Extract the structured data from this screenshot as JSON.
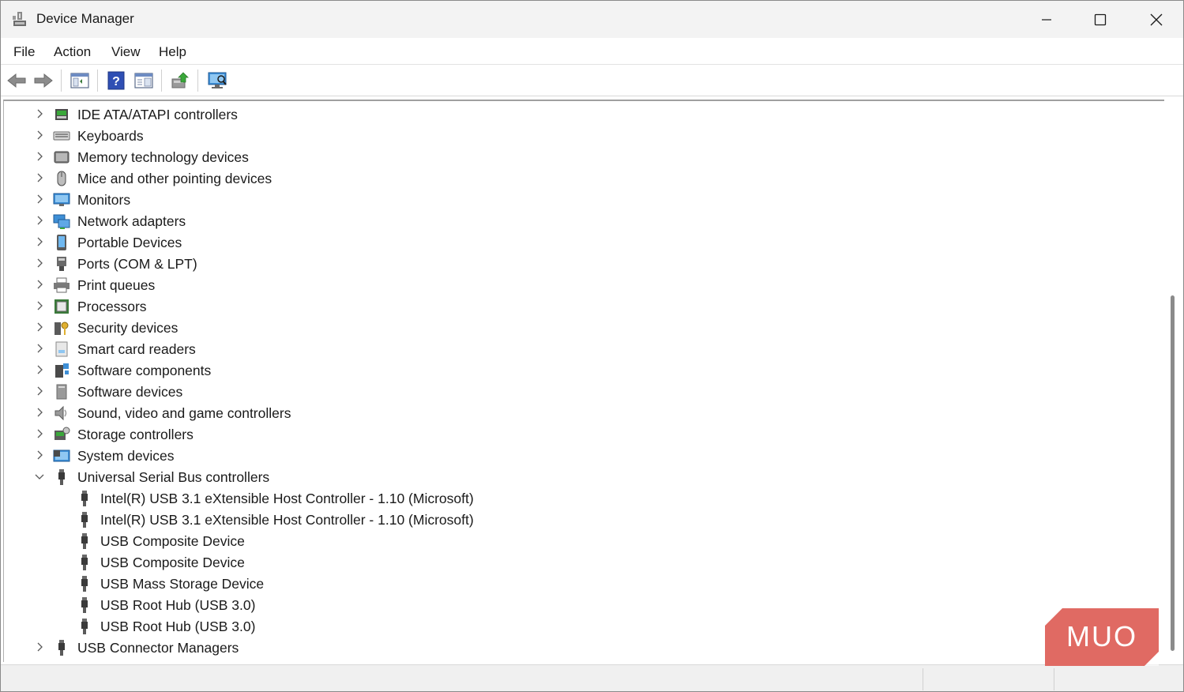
{
  "window": {
    "title": "Device Manager"
  },
  "menu": [
    "File",
    "Action",
    "View",
    "Help"
  ],
  "toolbar": {
    "buttons": [
      "back-icon",
      "forward-icon",
      "show-hide-console-tree-icon",
      "help-icon",
      "properties-pane-icon",
      "update-driver-icon",
      "scan-hardware-icon"
    ]
  },
  "tree": {
    "categories": [
      {
        "label": "IDE ATA/ATAPI controllers",
        "icon": "ide-controller-icon",
        "expanded": false
      },
      {
        "label": "Keyboards",
        "icon": "keyboard-icon",
        "expanded": false
      },
      {
        "label": "Memory technology devices",
        "icon": "memory-device-icon",
        "expanded": false
      },
      {
        "label": "Mice and other pointing devices",
        "icon": "mouse-icon",
        "expanded": false
      },
      {
        "label": "Monitors",
        "icon": "monitor-icon",
        "expanded": false
      },
      {
        "label": "Network adapters",
        "icon": "network-adapter-icon",
        "expanded": false
      },
      {
        "label": "Portable Devices",
        "icon": "portable-device-icon",
        "expanded": false
      },
      {
        "label": "Ports (COM & LPT)",
        "icon": "port-icon",
        "expanded": false
      },
      {
        "label": "Print queues",
        "icon": "printer-icon",
        "expanded": false
      },
      {
        "label": "Processors",
        "icon": "processor-icon",
        "expanded": false
      },
      {
        "label": "Security devices",
        "icon": "security-device-icon",
        "expanded": false
      },
      {
        "label": "Smart card readers",
        "icon": "smart-card-reader-icon",
        "expanded": false
      },
      {
        "label": "Software components",
        "icon": "software-component-icon",
        "expanded": false
      },
      {
        "label": "Software devices",
        "icon": "software-device-icon",
        "expanded": false
      },
      {
        "label": "Sound, video and game controllers",
        "icon": "speaker-icon",
        "expanded": false
      },
      {
        "label": "Storage controllers",
        "icon": "storage-controller-icon",
        "expanded": false
      },
      {
        "label": "System devices",
        "icon": "system-device-icon",
        "expanded": false
      },
      {
        "label": "Universal Serial Bus controllers",
        "icon": "usb-icon",
        "expanded": true,
        "children": [
          "Intel(R) USB 3.1 eXtensible Host Controller - 1.10 (Microsoft)",
          "Intel(R) USB 3.1 eXtensible Host Controller - 1.10 (Microsoft)",
          "USB Composite Device",
          "USB Composite Device",
          "USB Mass Storage Device",
          "USB Root Hub (USB 3.0)",
          "USB Root Hub (USB 3.0)"
        ]
      },
      {
        "label": "USB Connector Managers",
        "icon": "usb-icon",
        "expanded": false
      }
    ]
  },
  "watermark": {
    "text": "MUO",
    "color": "#e06a63"
  }
}
